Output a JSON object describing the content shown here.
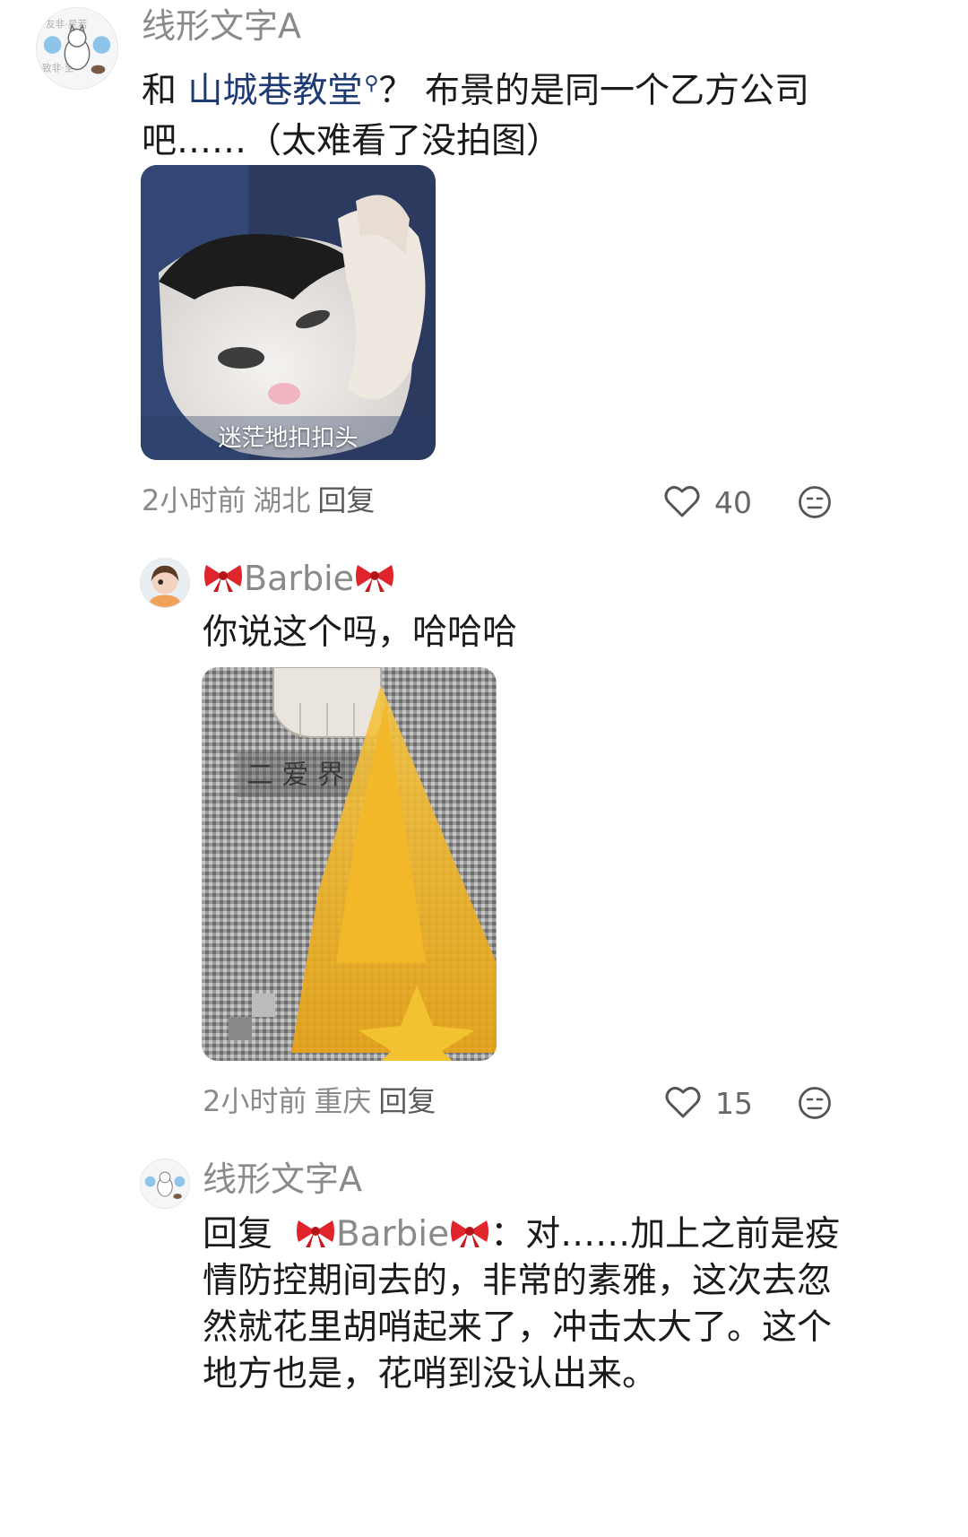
{
  "comments": [
    {
      "username": "线形文字A",
      "text_before": "和 ",
      "link_text": "山城巷教堂",
      "text_after": "？ 布景的是同一个乙方公司吧……（太难看了没拍图）",
      "sticker_caption": "迷茫地扣扣头",
      "time": "2小时前",
      "location": "湖北",
      "reply_label": "回复",
      "likes": "40"
    },
    {
      "username": "Barbie",
      "text": "你说这个吗，哈哈哈",
      "time": "2小时前",
      "location": "重庆",
      "reply_label": "回复",
      "likes": "15"
    },
    {
      "username": "线形文字A",
      "reply_prefix": "回复",
      "mention": "Barbie",
      "text": "：对……加上之前是疫情防控期间去的，非常的素雅，这次去忽然就花里胡哨起来了，冲击太大了。这个地方也是，花哨到没认出来。"
    }
  ],
  "icons": {
    "like": "heart-outline-icon",
    "emoji": "emoji-face-icon",
    "search": "search-icon"
  },
  "colors": {
    "link": "#1f3b73",
    "meta": "#8a8a8a",
    "bow": "#e0242b"
  }
}
